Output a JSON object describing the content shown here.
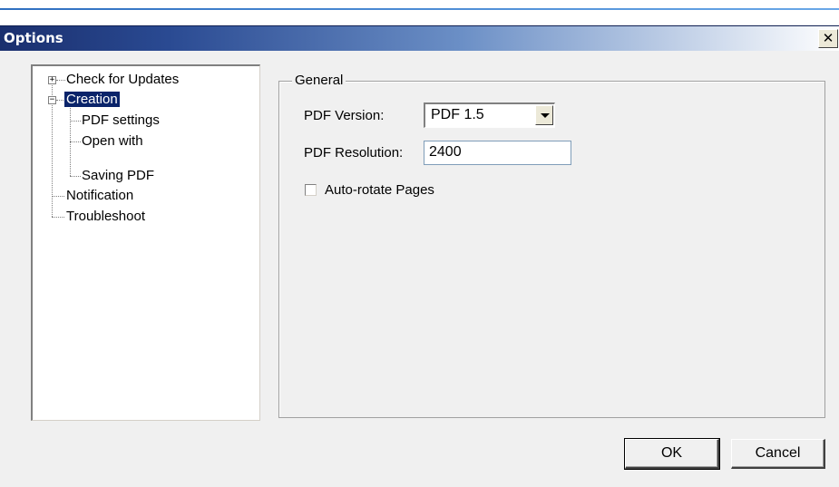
{
  "window": {
    "title": "Options",
    "close_glyph": "✕"
  },
  "tree": {
    "items": [
      {
        "label": "Check for Updates",
        "expander": "+"
      },
      {
        "label": "Creation",
        "expander": "−",
        "selected": true
      },
      {
        "label": "PDF settings"
      },
      {
        "label": "Open with"
      },
      {
        "label": "Saving PDF"
      },
      {
        "label": "Notification"
      },
      {
        "label": "Troubleshoot"
      }
    ]
  },
  "general": {
    "legend": "General",
    "pdf_version_label": "PDF Version:",
    "pdf_version_value": "PDF 1.5",
    "pdf_resolution_label": "PDF Resolution:",
    "pdf_resolution_value": "2400",
    "auto_rotate_label": "Auto-rotate Pages",
    "auto_rotate_checked": false
  },
  "buttons": {
    "ok": "OK",
    "cancel": "Cancel"
  },
  "colors": {
    "title_bar": "#1a2f6e",
    "selection": "#0a246a",
    "dialog_bg": "#f0f0f0"
  }
}
